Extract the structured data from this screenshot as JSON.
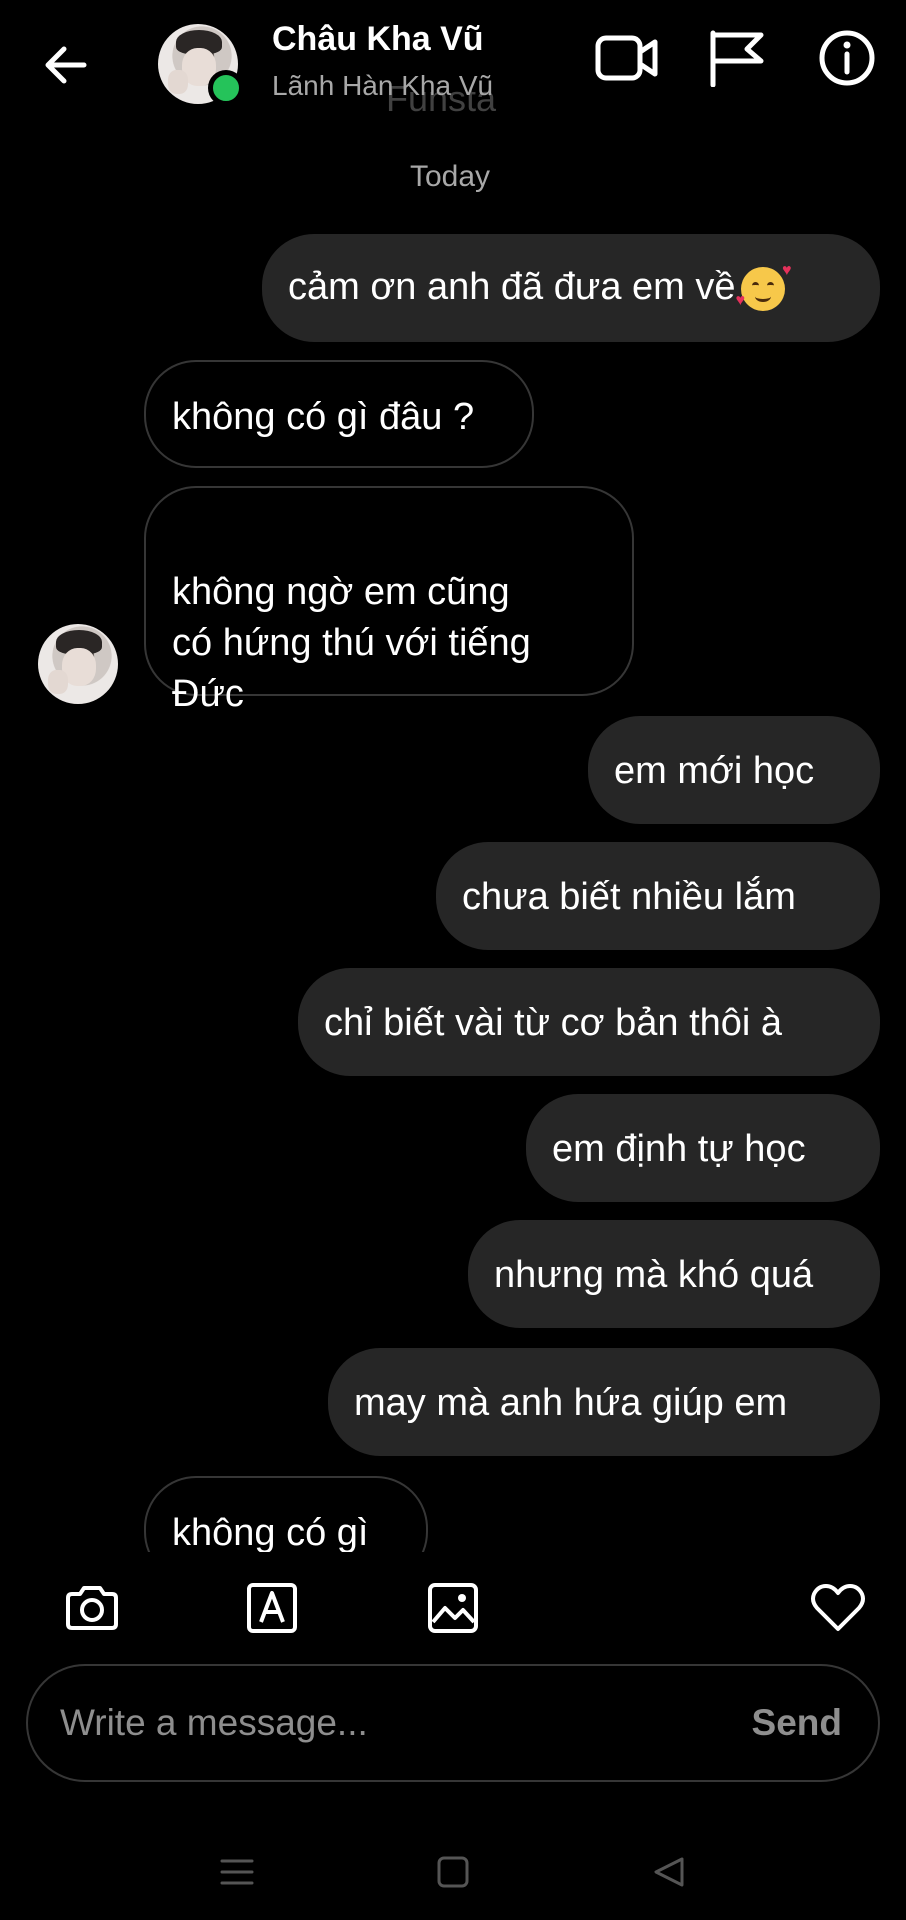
{
  "header": {
    "contact_name": "Châu Kha Vũ",
    "username": "Lãnh Hàn Kha Vũ",
    "watermark": "Funsta",
    "icons": [
      "back-arrow-icon",
      "video-call-icon",
      "flag-icon",
      "info-icon"
    ],
    "online_color": "#25c35a"
  },
  "thread": {
    "date_label": "Today",
    "messages": [
      {
        "from": "me",
        "text": "cảm ơn anh đã đưa em về",
        "emoji": "smiling-face-with-hearts"
      },
      {
        "from": "them",
        "text": "không có gì đâu ?"
      },
      {
        "from": "them",
        "text": "không ngờ em cũng\ncó hứng thú với tiếng\nĐức"
      },
      {
        "from": "me",
        "text": "em mới học"
      },
      {
        "from": "me",
        "text": "chưa biết nhiều lắm"
      },
      {
        "from": "me",
        "text": "chỉ biết vài từ cơ bản thôi à"
      },
      {
        "from": "me",
        "text": "em định tự học"
      },
      {
        "from": "me",
        "text": "nhưng mà khó quá"
      },
      {
        "from": "me",
        "text": "may mà anh hứa giúp em"
      },
      {
        "from": "them",
        "text": "không có gì"
      }
    ]
  },
  "composer": {
    "placeholder": "Write a message...",
    "send_label": "Send",
    "icons": [
      "camera-icon",
      "text-sticker-icon",
      "gallery-icon",
      "heart-icon"
    ]
  },
  "colors": {
    "background": "#000000",
    "sent_bubble": "#262626",
    "received_border": "#363636",
    "muted_text": "#8e8e8e"
  }
}
